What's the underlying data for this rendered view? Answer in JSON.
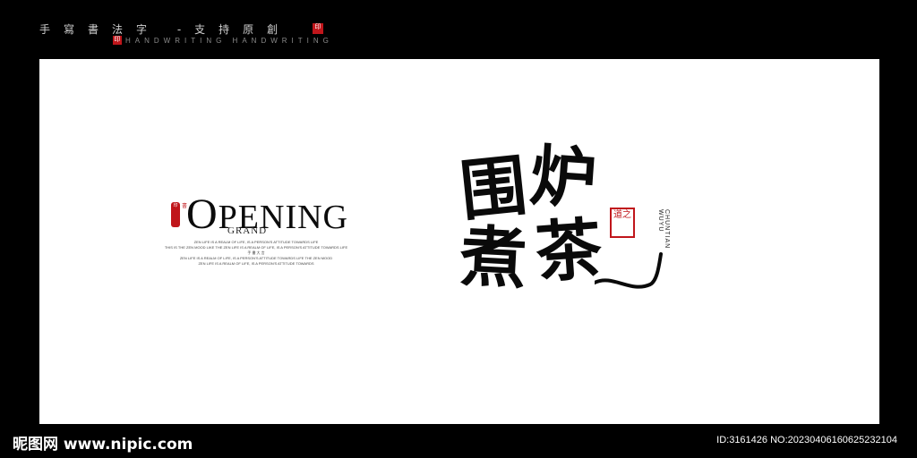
{
  "header": {
    "title_cn": "手寫書法字 -支持原創",
    "subtitle_en": "HANDWRITING  HANDWRITING",
    "seal_text": "印"
  },
  "design": {
    "opening_first": "O",
    "opening_rest": "PENING",
    "grand": "GRAND",
    "small_lines": [
      "ZEN LIFE IS A REALM OF LIFE, IS A PERSON'S ATTITUDE TOWARDS LIFE",
      "THIS IS THE ZEN MOOD LIKE THE ZEN LIFE IS A REALM OF LIFE, IS A PERSON'S ATTITUDE TOWARDS LIFE",
      "手 書 大 言",
      "ZEN LIFE IS A REALM OF LIFE, IS A PERSON'S ATTITUDE TOWARDS LIFE THE ZEN MOOD",
      "ZEN LIFE IS A REALM OF LIFE, IS A PERSON'S ATTITUDE TOWARDS"
    ],
    "calligraphy": [
      "围",
      "炉",
      "煮",
      "茶"
    ],
    "seal_right": "道之",
    "vertical_en": "CHUNTIAN WUYU"
  },
  "footer": {
    "logo": "昵图网 www.nipic.com",
    "id": "ID:3161426 NO:20230406160625232104"
  },
  "colors": {
    "seal_red": "#c0161b",
    "background": "#000000",
    "canvas": "#ffffff"
  }
}
